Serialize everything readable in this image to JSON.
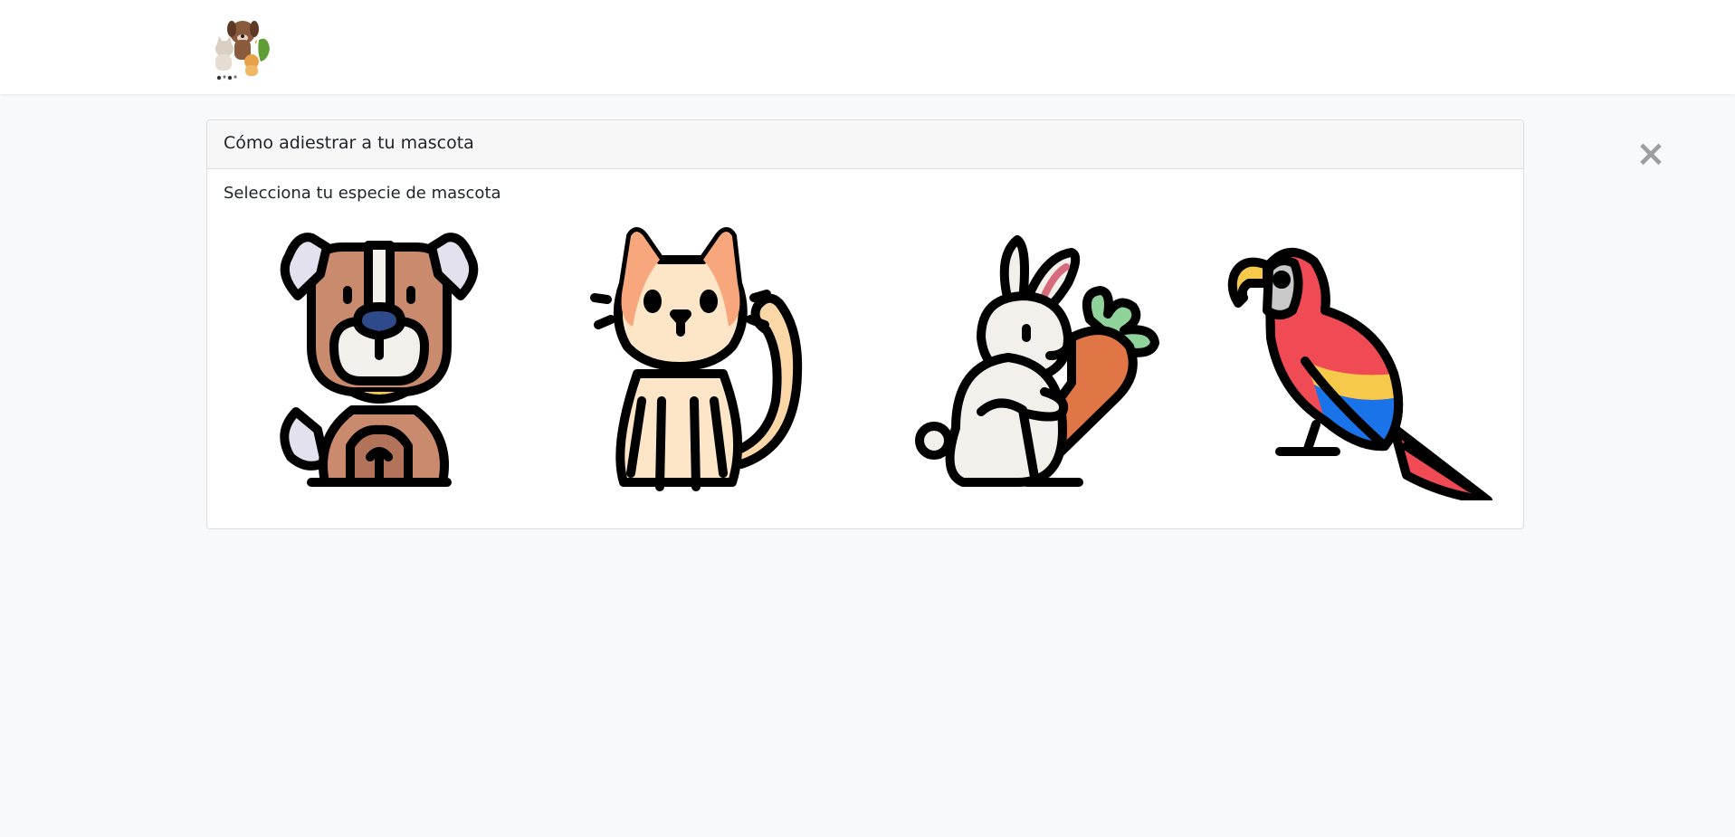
{
  "app": {
    "logo_icon": "pets-logo-icon",
    "close_label": "×"
  },
  "card": {
    "title": "Cómo adiestrar a tu mascota",
    "subtitle": "Selecciona tu especie de mascota"
  },
  "species": [
    {
      "icon": "dog-icon",
      "color": "#c98a6e"
    },
    {
      "icon": "cat-icon",
      "color": "#f8a77d"
    },
    {
      "icon": "rabbit-icon",
      "color": "#f3efea"
    },
    {
      "icon": "parrot-icon",
      "color": "#f04b55"
    }
  ],
  "colors": {
    "background": "#f8f9fa",
    "navbar": "#ffffff",
    "card_header": "#f7f7f7",
    "close": "#9e9e9e"
  }
}
